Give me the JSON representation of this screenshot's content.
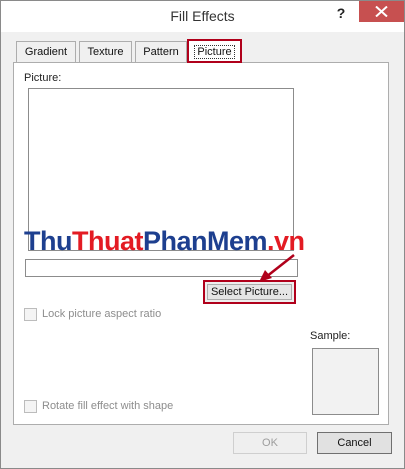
{
  "window": {
    "title": "Fill Effects",
    "help_label": "?"
  },
  "tabs": [
    {
      "label": "Gradient"
    },
    {
      "label": "Texture"
    },
    {
      "label": "Pattern"
    },
    {
      "label": "Picture"
    }
  ],
  "picture_panel": {
    "picture_label": "Picture:",
    "filename_value": "",
    "select_button_label": "Select Picture...",
    "lock_aspect_label": "Lock picture aspect ratio",
    "lock_aspect_checked": false,
    "rotate_fill_label": "Rotate fill effect with shape",
    "rotate_fill_checked": false,
    "sample_label": "Sample:"
  },
  "watermark": {
    "part1": "Thu",
    "part2": "Thuat",
    "part3": "PhanMem",
    "part4": ".vn"
  },
  "footer": {
    "ok_label": "OK",
    "cancel_label": "Cancel"
  },
  "colors": {
    "highlight": "#b0001b",
    "close_button": "#c75050",
    "watermark_blue": "#1d3f8f",
    "watermark_red": "#e31b23"
  }
}
